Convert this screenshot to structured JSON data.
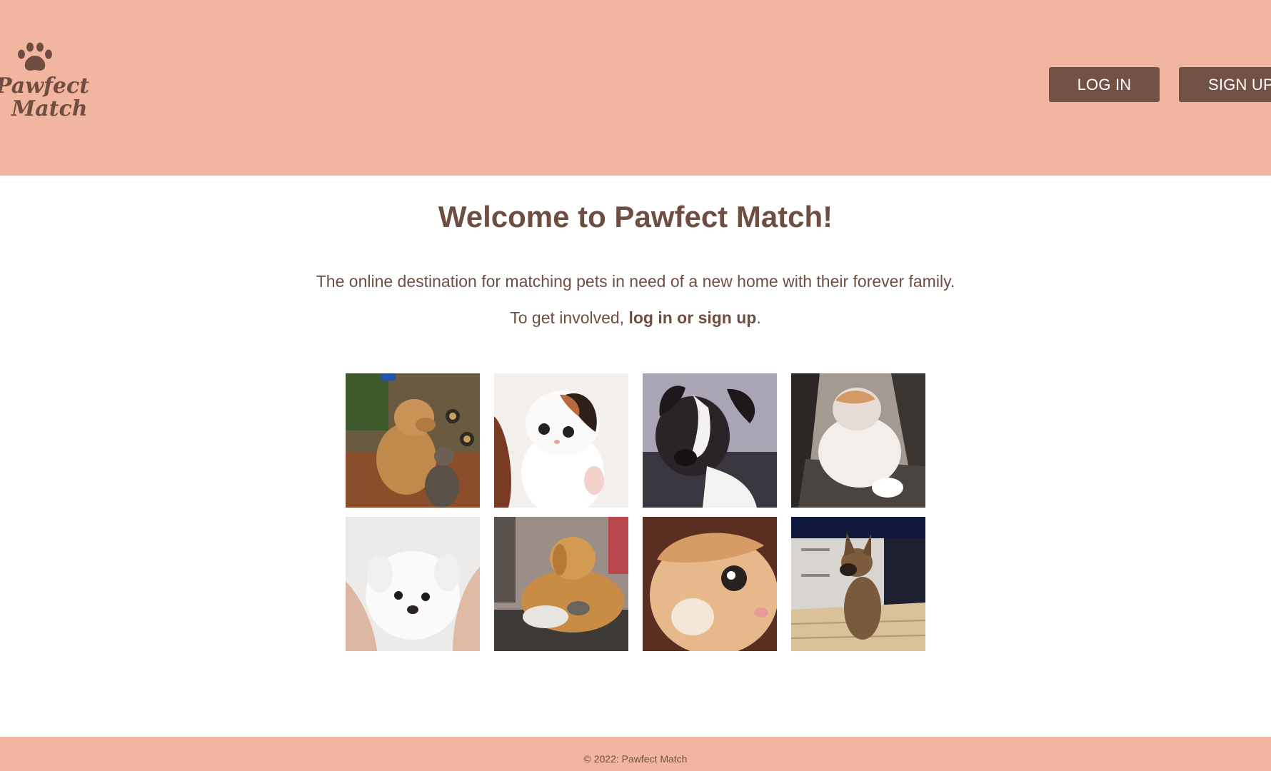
{
  "brand": {
    "logo_line1": "Pawfect",
    "logo_line2": "Match"
  },
  "header": {
    "login_label": "LOG IN",
    "signup_label": "SIGN UP"
  },
  "main": {
    "title": "Welcome to Pawfect Match!",
    "tagline": "The online destination for matching pets in need of a new home with their forever family.",
    "involved_prefix": "To get involved, ",
    "involved_link": "log in or sign up",
    "involved_suffix": "."
  },
  "gallery": [
    {
      "subject": "golden retriever and tabby cat"
    },
    {
      "subject": "white kitten with black patch"
    },
    {
      "subject": "black and white dog"
    },
    {
      "subject": "orange and white cat"
    },
    {
      "subject": "white fluffy puppy"
    },
    {
      "subject": "golden retriever with kitten"
    },
    {
      "subject": "orange cat close-up"
    },
    {
      "subject": "german shepherd puppy"
    }
  ],
  "footer": {
    "copyright": "© 2022: Pawfect Match"
  },
  "colors": {
    "header_bg": "#f2b6a0",
    "button_bg": "#735246",
    "text": "#6f4e42"
  }
}
